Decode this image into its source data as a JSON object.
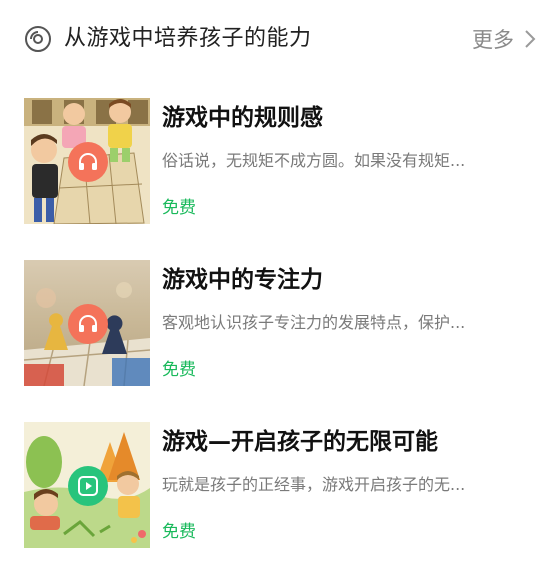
{
  "section": {
    "title": "从游戏中培养孩子的能力",
    "more_label": "更多"
  },
  "items": [
    {
      "title": "游戏中的规则感",
      "description": "俗话说，无规矩不成方圆。如果没有规矩...",
      "price": "免费",
      "badge": "headphones-icon",
      "badge_color": "#f4735a"
    },
    {
      "title": "游戏中的专注力",
      "description": "客观地认识孩子专注力的发展特点，保护...",
      "price": "免费",
      "badge": "headphones-icon",
      "badge_color": "#f4735a"
    },
    {
      "title": "游戏—开启孩子的无限可能",
      "description": "玩就是孩子的正经事，游戏开启孩子的无...",
      "price": "免费",
      "badge": "play-icon",
      "badge_color": "#28c47c"
    }
  ],
  "colors": {
    "price": "#19b95b",
    "more": "#8a8a8a"
  }
}
